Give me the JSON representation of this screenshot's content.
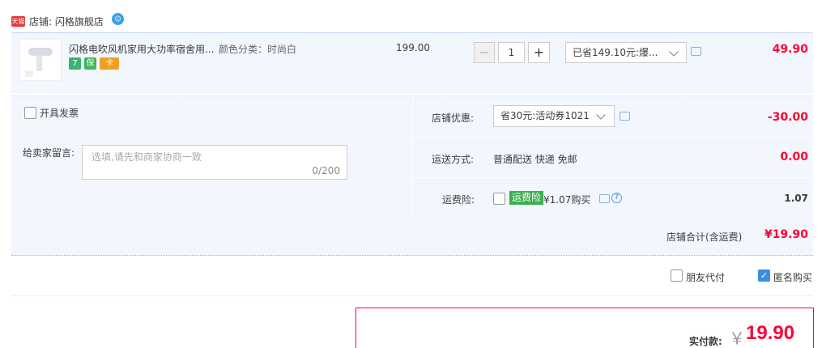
{
  "shop": {
    "badge": "天猫",
    "label": "店铺: 闪格旗舰店"
  },
  "item": {
    "title": "闪格电吹风机家用大功率宿舍用...",
    "sku": "颜色分类：时尚白",
    "service_icons": [
      "7",
      "保",
      "卡"
    ],
    "unit_price": "199.00",
    "quantity": "1",
    "minus": "−",
    "plus": "+",
    "promo": "已省149.10元:爆...",
    "subtotal": "49.90"
  },
  "options": {
    "invoice_label": "开具发票",
    "message_label": "给卖家留言:",
    "message_placeholder": "选填,请先和商家协商一致",
    "message_count": "0/200",
    "shop_discount_label": "店铺优惠:",
    "coupon_selected": "省30元:活动券1021",
    "discount_amount": "-30.00",
    "shipping_label": "运送方式:",
    "shipping_method": "普通配送 快递 免邮",
    "shipping_fee": "0.00",
    "insurance_label": "运费险:",
    "insurance_badge": "运费险",
    "insurance_price": "¥1.07购买",
    "insurance_amount": "1.07",
    "help": "?"
  },
  "total": {
    "label": "店铺合计(含运费)",
    "amount": "¥19.90"
  },
  "extras": {
    "friend_pay": "朋友代付",
    "anonymous": "匿名购买",
    "anonymous_checked": true,
    "check_mark": "✓"
  },
  "payment": {
    "label": "实付款:",
    "currency": "￥",
    "amount": "19.90"
  },
  "colors": {
    "price_red": "#ff0036",
    "panel_bg": "#f2f6fd",
    "checkbox_blue": "#3a8ee6"
  }
}
